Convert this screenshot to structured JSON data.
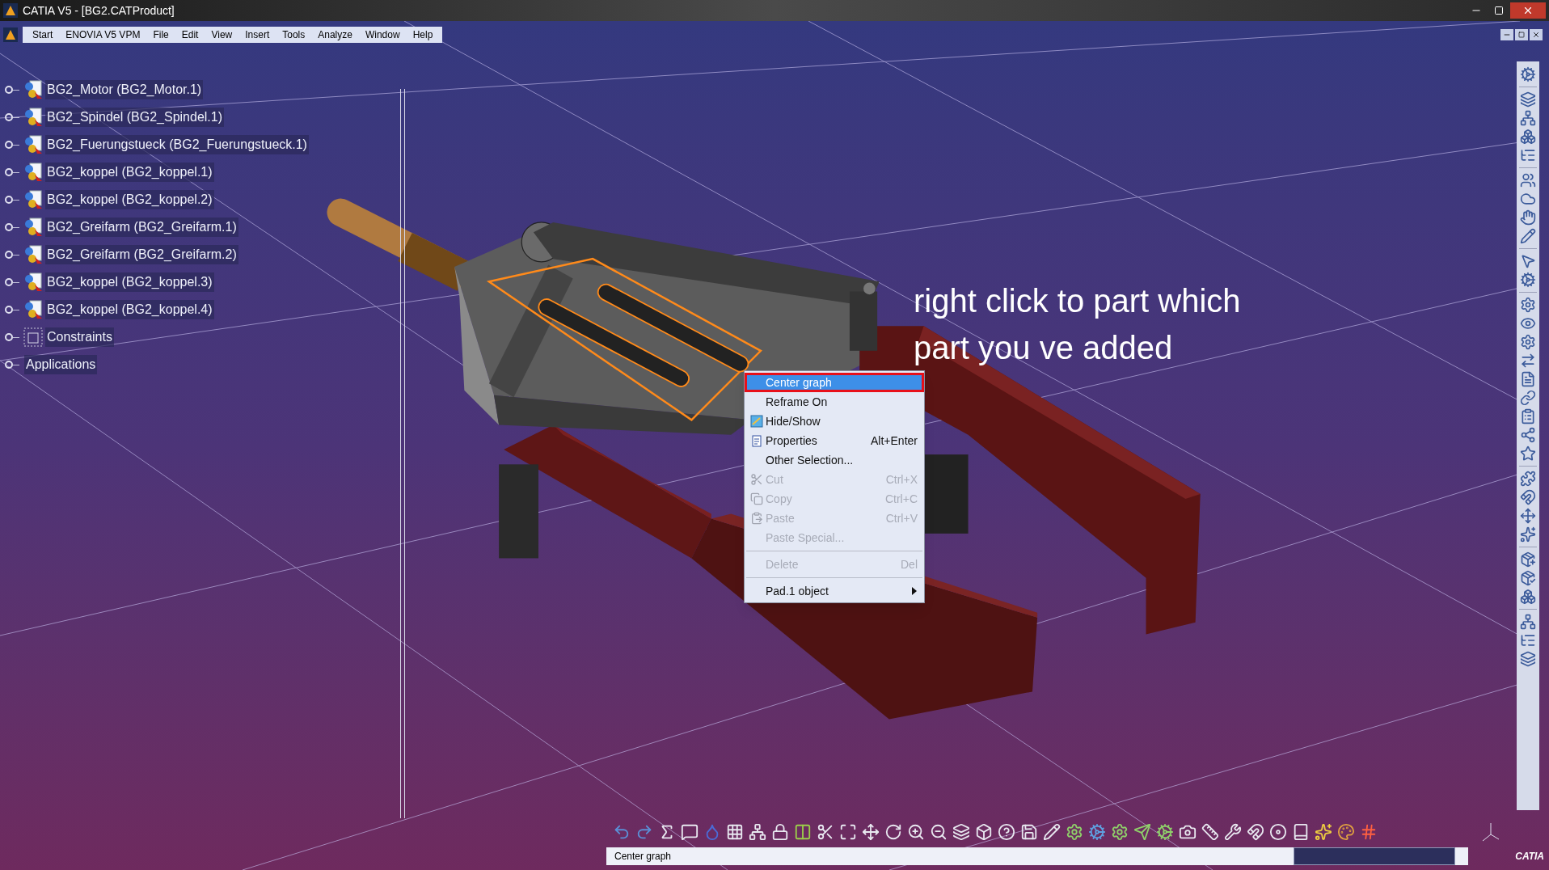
{
  "window": {
    "title": "CATIA V5 - [BG2.CATProduct]"
  },
  "menu_bar": [
    "Start",
    "ENOVIA V5 VPM",
    "File",
    "Edit",
    "View",
    "Insert",
    "Tools",
    "Analyze",
    "Window",
    "Help"
  ],
  "tree": {
    "items": [
      {
        "label": "BG2_Motor (BG2_Motor.1)",
        "kind": "product"
      },
      {
        "label": "BG2_Spindel (BG2_Spindel.1)",
        "kind": "product"
      },
      {
        "label": "BG2_Fuerungstueck (BG2_Fuerungstueck.1)",
        "kind": "product"
      },
      {
        "label": "BG2_koppel (BG2_koppel.1)",
        "kind": "product"
      },
      {
        "label": "BG2_koppel (BG2_koppel.2)",
        "kind": "product"
      },
      {
        "label": "BG2_Greifarm (BG2_Greifarm.1)",
        "kind": "product"
      },
      {
        "label": "BG2_Greifarm (BG2_Greifarm.2)",
        "kind": "product"
      },
      {
        "label": "BG2_koppel (BG2_koppel.3)",
        "kind": "product"
      },
      {
        "label": "BG2_koppel (BG2_koppel.4)",
        "kind": "product"
      },
      {
        "label": "Constraints",
        "kind": "constraints"
      },
      {
        "label": "Applications",
        "kind": "applications"
      }
    ]
  },
  "annotation": [
    "right click to part which",
    "part you ve added"
  ],
  "context_menu": {
    "items": [
      {
        "kind": "item",
        "label": "Center graph",
        "selected": true,
        "highlighted": true,
        "disabled": false
      },
      {
        "kind": "item",
        "label": "Reframe On",
        "selected": false,
        "highlighted": false,
        "disabled": false
      },
      {
        "kind": "item",
        "label": "Hide/Show",
        "selected": false,
        "highlighted": false,
        "disabled": false
      },
      {
        "kind": "item",
        "label": "Properties",
        "shortcut": "Alt+Enter",
        "selected": false,
        "highlighted": false,
        "disabled": false
      },
      {
        "kind": "item",
        "label": "Other Selection...",
        "selected": false,
        "highlighted": false,
        "disabled": false
      },
      {
        "kind": "item",
        "label": "Cut",
        "shortcut": "Ctrl+X",
        "selected": false,
        "highlighted": false,
        "disabled": true
      },
      {
        "kind": "item",
        "label": "Copy",
        "shortcut": "Ctrl+C",
        "selected": false,
        "highlighted": false,
        "disabled": true
      },
      {
        "kind": "item",
        "label": "Paste",
        "shortcut": "Ctrl+V",
        "selected": false,
        "highlighted": false,
        "disabled": true
      },
      {
        "kind": "item",
        "label": "Paste Special...",
        "selected": false,
        "highlighted": false,
        "disabled": true
      },
      {
        "kind": "separator"
      },
      {
        "kind": "item",
        "label": "Delete",
        "shortcut": "Del",
        "selected": false,
        "highlighted": false,
        "disabled": true
      },
      {
        "kind": "separator"
      },
      {
        "kind": "submenu",
        "label": "Pad.1 object",
        "selected": false,
        "highlighted": false,
        "disabled": false
      }
    ]
  },
  "status_bar": {
    "message": "Center graph"
  },
  "logo_text": "CATIA"
}
